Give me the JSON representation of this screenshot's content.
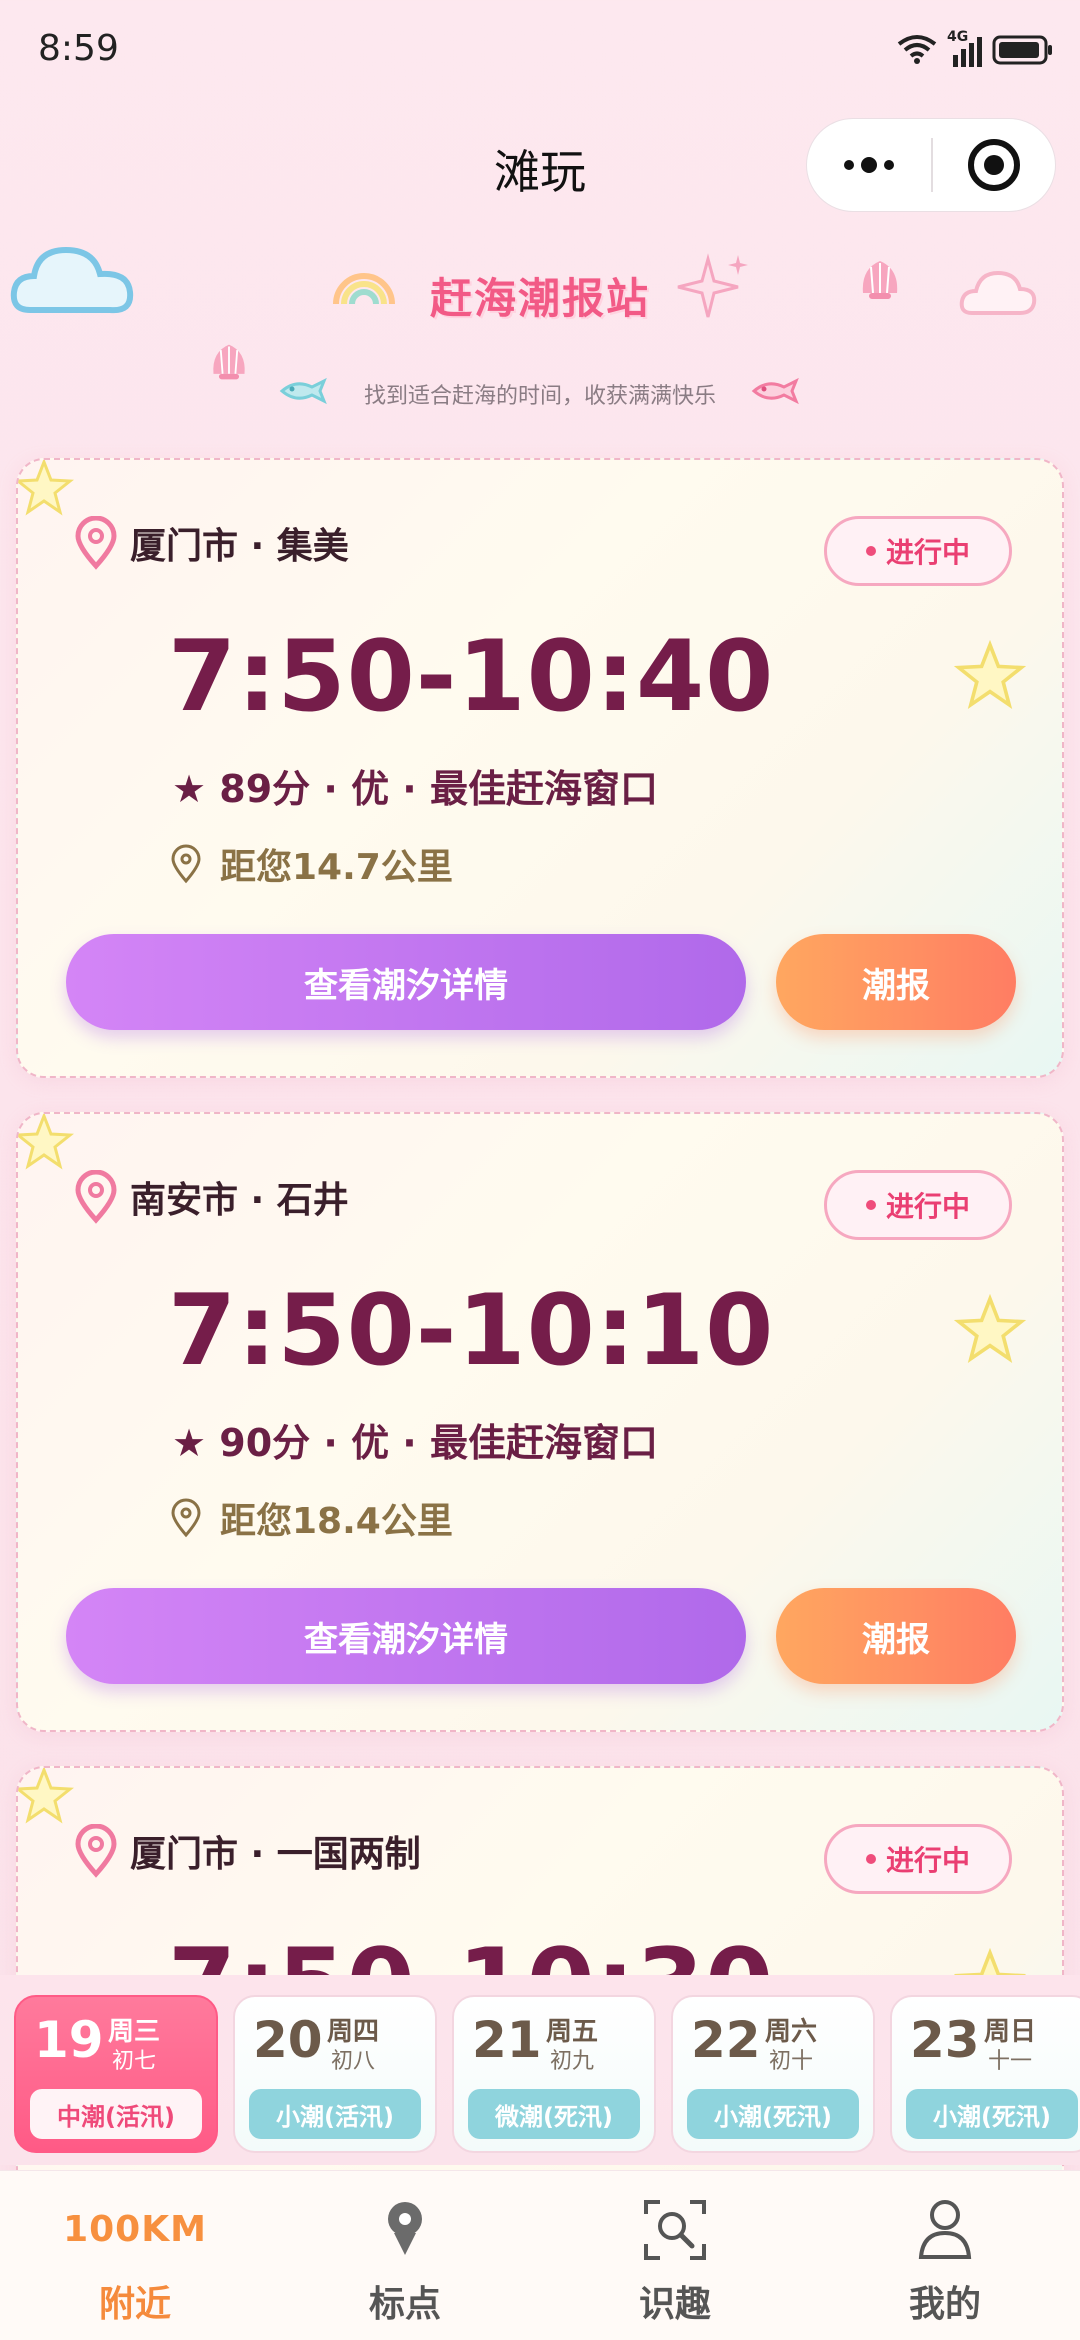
{
  "status": {
    "time": "8:59",
    "network": "4G"
  },
  "header": {
    "title": "滩玩"
  },
  "banner": {
    "title": "赶海潮报站",
    "subtitle": "找到适合赶海的时间，收获满满快乐"
  },
  "cards": [
    {
      "location": "厦门市 · 集美",
      "status": "进行中",
      "time_range": "7:50-10:40",
      "score_line": "★ 89分 · 优 · 最佳赶海窗口",
      "distance": "距您14.7公里",
      "detail_button": "查看潮汐详情",
      "report_button": "潮报"
    },
    {
      "location": "南安市 · 石井",
      "status": "进行中",
      "time_range": "7:50-10:10",
      "score_line": "★ 90分 · 优 · 最佳赶海窗口",
      "distance": "距您18.4公里",
      "detail_button": "查看潮汐详情",
      "report_button": "潮报"
    },
    {
      "location": "厦门市 · 一国两制",
      "status": "进行中",
      "time_range": "7:50-10:30",
      "score_line": "",
      "distance": "",
      "detail_button": "",
      "report_button": ""
    }
  ],
  "dates": [
    {
      "day": "19",
      "weekday": "周三",
      "lunar": "初七",
      "tide": "中潮(活汛)",
      "selected": true
    },
    {
      "day": "20",
      "weekday": "周四",
      "lunar": "初八",
      "tide": "小潮(活汛)",
      "selected": false
    },
    {
      "day": "21",
      "weekday": "周五",
      "lunar": "初九",
      "tide": "微潮(死汛)",
      "selected": false
    },
    {
      "day": "22",
      "weekday": "周六",
      "lunar": "初十",
      "tide": "小潮(死汛)",
      "selected": false
    },
    {
      "day": "23",
      "weekday": "周日",
      "lunar": "十一",
      "tide": "小潮(死汛)",
      "selected": false
    }
  ],
  "tabs": [
    {
      "label": "附近",
      "top_text": "100KM",
      "icon": "range-text",
      "active": true
    },
    {
      "label": "标点",
      "icon": "map-pin-icon",
      "active": false
    },
    {
      "label": "识趣",
      "icon": "scan-search-icon",
      "active": false
    },
    {
      "label": "我的",
      "icon": "user-icon",
      "active": false
    }
  ],
  "colors": {
    "accent_pink": "#f25a86",
    "time_text": "#751d4a",
    "detail_button": "#b069ea",
    "report_button": "#ff7d63",
    "tab_active": "#f58a3c",
    "tide_tag": "#8fd4dd"
  }
}
